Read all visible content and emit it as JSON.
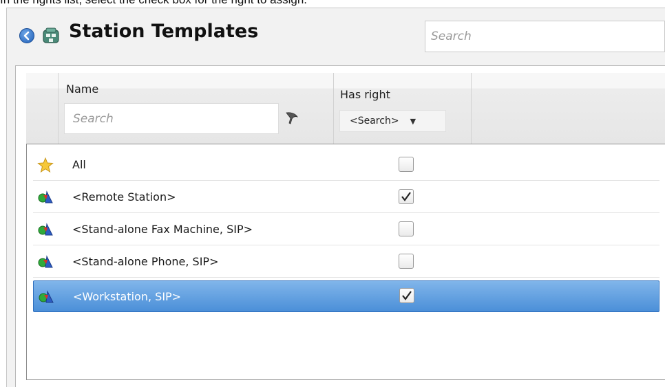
{
  "instruction": "In the rights list, select the check box for the right to assign.",
  "header": {
    "title": "Station Templates",
    "search_placeholder": "Search",
    "back_icon": "back-arrow-icon",
    "templates_icon": "station-templates-icon"
  },
  "grid": {
    "columns": {
      "name": {
        "label": "Name",
        "search_placeholder": "Search",
        "filter_icon": "filter-icon"
      },
      "has_right": {
        "label": "Has right",
        "filter_value": "<Search>"
      }
    },
    "rows": [
      {
        "label": "All",
        "icon": "star-icon",
        "checked": false,
        "selected": false
      },
      {
        "label": "<Remote Station>",
        "icon": "station-shapes-icon",
        "checked": true,
        "selected": false
      },
      {
        "label": "<Stand-alone Fax Machine, SIP>",
        "icon": "station-shapes-icon",
        "checked": false,
        "selected": false
      },
      {
        "label": "<Stand-alone Phone, SIP>",
        "icon": "station-shapes-icon",
        "checked": false,
        "selected": false
      },
      {
        "label": "<Workstation, SIP>",
        "icon": "station-shapes-icon",
        "checked": true,
        "selected": true
      }
    ]
  },
  "colors": {
    "selection_top": "#80b5ea",
    "selection_bottom": "#4b8fd8",
    "back_button": "#1f5fb8"
  }
}
